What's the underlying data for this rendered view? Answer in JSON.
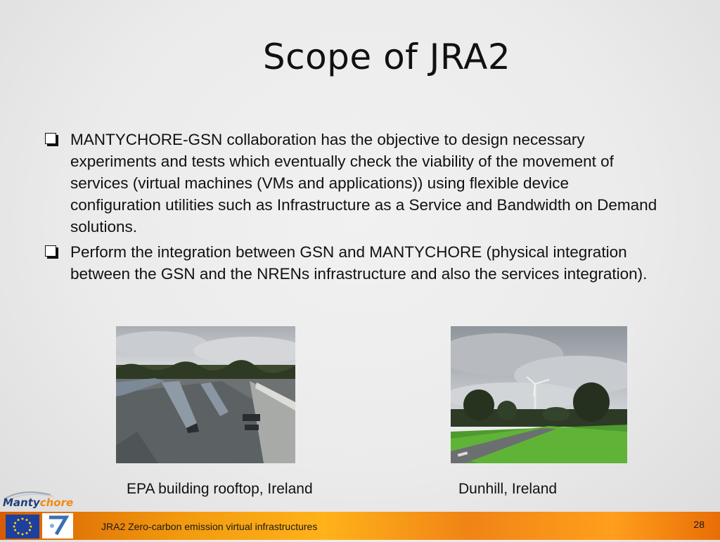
{
  "slide": {
    "title": "Scope of  JRA2",
    "bullets": [
      "MANTYCHORE-GSN collaboration has the objective to design necessary experiments and tests which eventually check the viability of the movement of services (virtual machines (VMs and applications)) using flexible device configuration utilities such as Infrastructure as a Service and Bandwidth on Demand solutions.",
      "Perform the integration between GSN and MANTYCHORE (physical integration between the GSN and the NRENs infrastructure and also the services  integration)."
    ],
    "images": [
      {
        "caption": "EPA building rooftop, Ireland"
      },
      {
        "caption": "Dunhill, Ireland"
      }
    ]
  },
  "logo": {
    "part1": "Manty",
    "part2": "chore"
  },
  "footer": {
    "text": "JRA2 Zero-carbon emission virtual infrastructures",
    "page_number": "28"
  }
}
